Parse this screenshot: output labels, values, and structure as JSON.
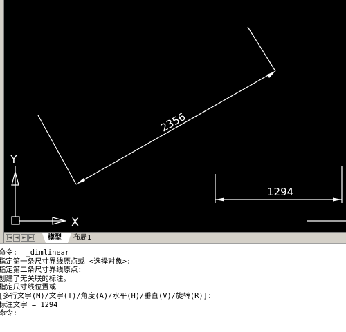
{
  "layout_tabs": {
    "model": "模型",
    "layout1": "布局1"
  },
  "ucs": {
    "x_label": "X",
    "y_label": "Y"
  },
  "dimensions": {
    "aligned_value": "2356",
    "linear_value": "1294"
  },
  "command_lines": [
    "命令:  _dimlinear",
    "指定第一条尺寸界线原点或 <选择对象>:",
    "指定第二条尺寸界线原点:",
    "创建了无关联的标注。",
    "指定尺寸线位置或",
    "[多行文字(M)/文字(T)/角度(A)/水平(H)/垂直(V)/旋转(R)]:",
    "标注文字 = 1294",
    "命令:"
  ],
  "colors": {
    "canvas": "#000000",
    "geometry": "#ffffff",
    "chrome": "#d4d0c8"
  },
  "icons": [
    "first-tab-icon",
    "prev-tab-icon",
    "next-tab-icon",
    "last-tab-icon",
    "ucs-icon"
  ]
}
